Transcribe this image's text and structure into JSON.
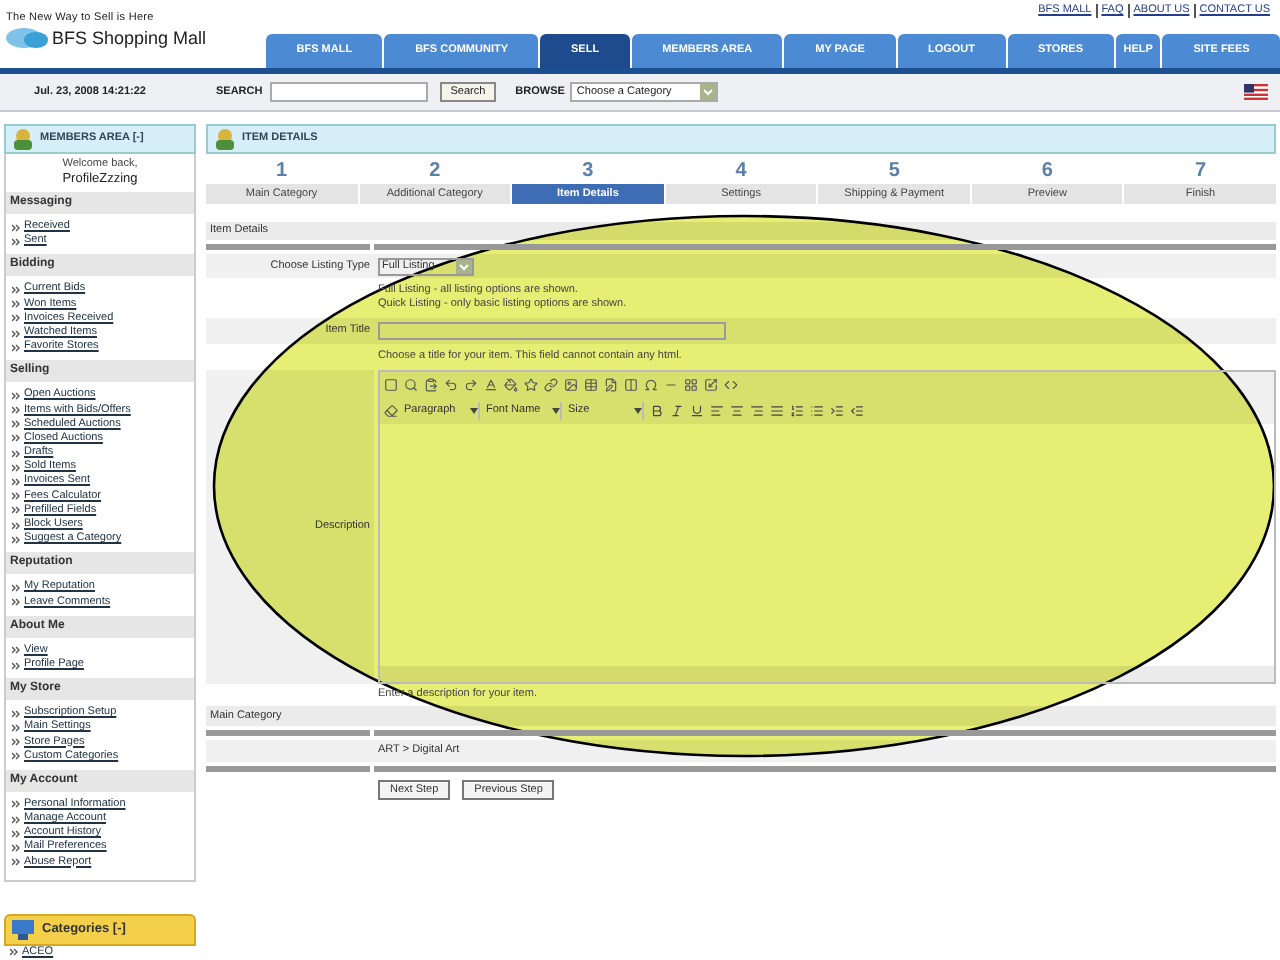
{
  "header": {
    "tagline": "The New Way to Sell is Here",
    "logo_text": "BFS Shopping Mall",
    "top_links": [
      "BFS MALL",
      "FAQ",
      "ABOUT US",
      "CONTACT US"
    ],
    "tabs": [
      {
        "label": "BFS MALL",
        "selected": false
      },
      {
        "label": "BFS COMMUNITY",
        "selected": false
      },
      {
        "label": "SELL",
        "selected": true
      },
      {
        "label": "MEMBERS AREA",
        "selected": false
      },
      {
        "label": "MY PAGE",
        "selected": false
      },
      {
        "label": "LOGOUT",
        "selected": false
      },
      {
        "label": "STORES",
        "selected": false
      },
      {
        "label": "HELP",
        "selected": false
      },
      {
        "label": "SITE FEES",
        "selected": false
      }
    ]
  },
  "search_bar": {
    "datetime": "Jul. 23, 2008 14:21:22",
    "search_label": "SEARCH",
    "search_button": "Search",
    "browse_label": "BROWSE",
    "browse_value": "Choose a Category"
  },
  "sidebar": {
    "title": "MEMBERS AREA [-]",
    "welcome": "Welcome back,",
    "username": "ProfileZzzing",
    "sections": [
      {
        "heading": "Messaging",
        "items": [
          "Received",
          "Sent"
        ]
      },
      {
        "heading": "Bidding",
        "items": [
          "Current Bids",
          "Won Items",
          "Invoices Received",
          "Watched Items",
          "Favorite Stores"
        ]
      },
      {
        "heading": "Selling",
        "items": [
          "Open Auctions",
          "Items with Bids/Offers",
          "Scheduled Auctions",
          "Closed Auctions",
          "Drafts",
          "Sold Items",
          "Invoices Sent",
          "Fees Calculator",
          "Prefilled Fields",
          "Block Users",
          "Suggest a Category"
        ]
      },
      {
        "heading": "Reputation",
        "items": [
          "My Reputation",
          "Leave Comments"
        ]
      },
      {
        "heading": "About Me",
        "items": [
          "View",
          "Profile Page"
        ]
      },
      {
        "heading": "My Store",
        "items": [
          "Subscription Setup",
          "Main Settings",
          "Store Pages",
          "Custom Categories"
        ]
      },
      {
        "heading": "My Account",
        "items": [
          "Personal Information",
          "Manage Account",
          "Account History",
          "Mail Preferences",
          "Abuse Report"
        ]
      }
    ],
    "categories": {
      "title": "Categories [-]",
      "items": [
        "ACEO"
      ]
    }
  },
  "main": {
    "title": "ITEM DETAILS",
    "steps": [
      {
        "number": "1",
        "label": "Main Category",
        "selected": false
      },
      {
        "number": "2",
        "label": "Additional Category",
        "selected": false
      },
      {
        "number": "3",
        "label": "Item Details",
        "selected": true
      },
      {
        "number": "4",
        "label": "Settings",
        "selected": false
      },
      {
        "number": "5",
        "label": "Shipping & Payment",
        "selected": false
      },
      {
        "number": "6",
        "label": "Preview",
        "selected": false
      },
      {
        "number": "7",
        "label": "Finish",
        "selected": false
      }
    ],
    "section_title": "Item Details",
    "listing_type": {
      "label": "Choose Listing Type",
      "value": "Full Listing",
      "help": [
        "Full Listing - all listing options are shown.",
        "Quick Listing - only basic listing options are shown."
      ]
    },
    "item_title": {
      "label": "Item Title",
      "help": "Choose a title for your item. This field cannot contain any html."
    },
    "description": {
      "label": "Description",
      "format_options": [
        "Paragraph",
        "Font Name",
        "Size"
      ],
      "help": "Enter a description for your item."
    },
    "main_category": {
      "title": "Main Category",
      "value": "ART > Digital Art"
    },
    "buttons": [
      "Next Step",
      "Previous Step"
    ]
  },
  "highlight": {
    "kind": "ellipse"
  }
}
